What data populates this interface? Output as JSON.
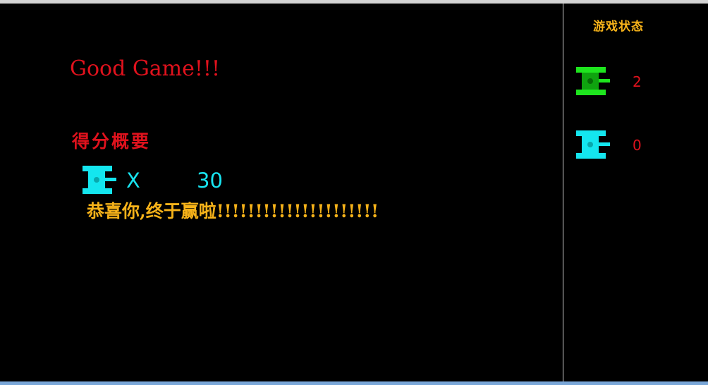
{
  "game": {
    "headline": "Good Game!!!",
    "score_summary_title": "得分概要",
    "score": {
      "multiplier": "X",
      "value": "30"
    },
    "win_message": "恭喜你,终于赢啦!!!!!!!!!!!!!!!!!!!!!"
  },
  "status_panel": {
    "title": "游戏状态",
    "rows": [
      {
        "icon": "green-tank-icon",
        "count": "2",
        "color": "#1ee51e"
      },
      {
        "icon": "cyan-tank-icon",
        "count": "0",
        "color": "#14e6ef"
      }
    ]
  },
  "colors": {
    "background": "#000000",
    "headline": "#e0121d",
    "score_text": "#18e4f0",
    "message": "#f6b219",
    "bottom_bar": "#7aa7d8"
  }
}
